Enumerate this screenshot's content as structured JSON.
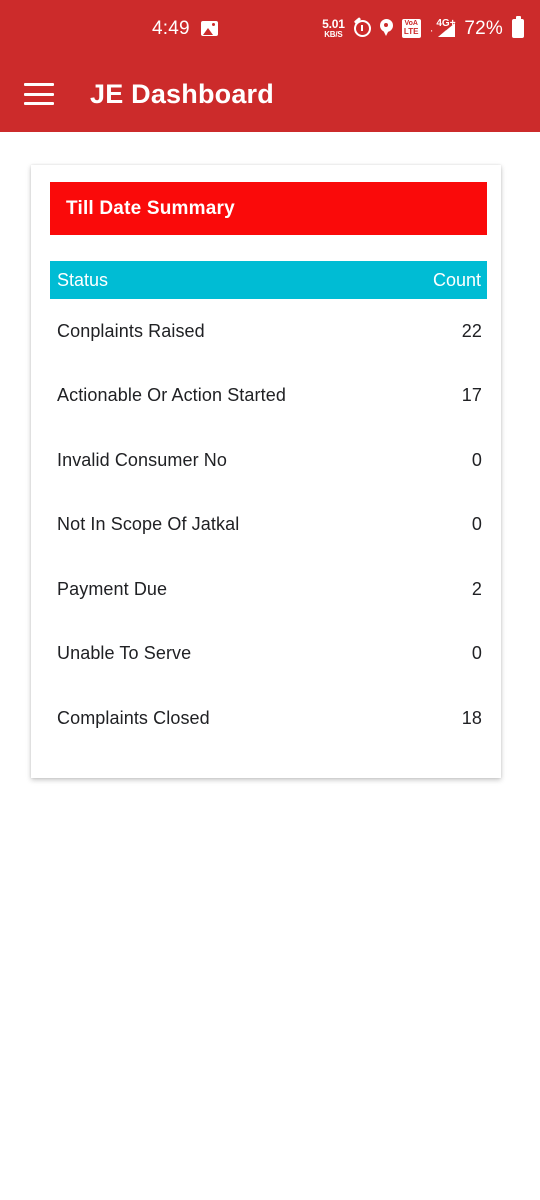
{
  "status_bar": {
    "time": "4:49",
    "photo_icon": "photo-icon",
    "network_speed_value": "5.01",
    "network_speed_unit": "KB/S",
    "alarm_icon": "alarm-icon",
    "location_icon": "location-pin-icon",
    "volte_line1": "VoA",
    "volte_line2": "LTE",
    "signal_dot": "·",
    "signal_label": "4G+",
    "battery_percent": "72%",
    "battery_icon": "battery-icon"
  },
  "app_bar": {
    "menu_icon": "hamburger-menu-icon",
    "title": "JE Dashboard",
    "background_color": "#cc2b2b"
  },
  "card": {
    "summary_title": "Till Date Summary",
    "summary_bar_color": "#fa0a0a",
    "table_header_color": "#00bcd4",
    "columns": {
      "status": "Status",
      "count": "Count"
    },
    "rows": [
      {
        "label": "Conplaints Raised",
        "count": "22"
      },
      {
        "label": "Actionable Or Action Started",
        "count": "17"
      },
      {
        "label": "Invalid Consumer No",
        "count": "0"
      },
      {
        "label": "Not In Scope Of Jatkal",
        "count": "0"
      },
      {
        "label": "Payment Due",
        "count": "2"
      },
      {
        "label": "Unable To Serve",
        "count": "0"
      },
      {
        "label": "Complaints Closed",
        "count": "18"
      }
    ]
  }
}
